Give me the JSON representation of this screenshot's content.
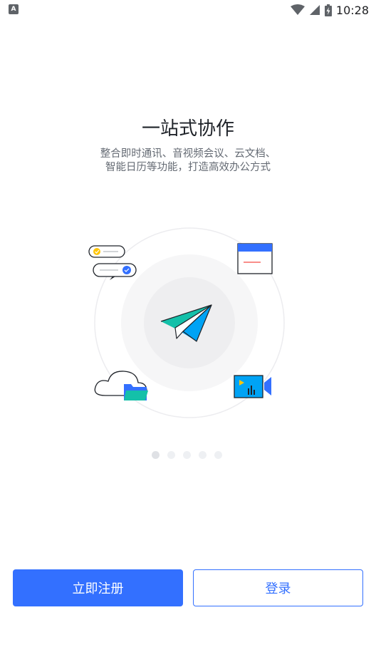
{
  "status_bar": {
    "time": "10:28",
    "left_icon_label": "A",
    "icons": [
      "wifi-icon",
      "cellular-signal-icon",
      "battery-charging-icon"
    ]
  },
  "onboarding": {
    "title": "一站式协作",
    "subtitle_line1": "整合即时通讯、音视频会议、云文档、",
    "subtitle_line2": "智能日历等功能，打造高效办公方式",
    "illustration_icons": [
      "chat-bubbles-icon",
      "calendar-window-icon",
      "paper-plane-icon",
      "cloud-folder-icon",
      "video-camera-icon"
    ],
    "page_indicator": {
      "count": 5,
      "active_index": 0
    }
  },
  "actions": {
    "register_label": "立即注册",
    "login_label": "登录"
  },
  "colors": {
    "primary": "#3370ff",
    "title": "#1f2329",
    "subtitle": "#646a73",
    "teal": "#14c0a9",
    "sky": "#00a3f5"
  }
}
